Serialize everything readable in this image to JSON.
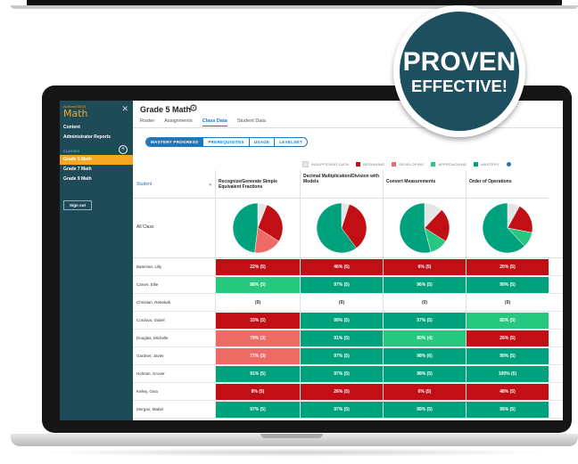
{
  "sidebar": {
    "brand_small": "Achieve3000",
    "brand_big": "Math",
    "nav": [
      "Content",
      "Administrator Reports"
    ],
    "classes_label": "CLASSES",
    "classes": [
      "Grade 5 Math",
      "Grade 7 Math",
      "Grade 9 Math"
    ],
    "active_class_index": 0,
    "sign_out": "Sign out"
  },
  "header": {
    "title": "Grade 5 Math",
    "tabs": [
      "Roster",
      "Assignments",
      "Class Data",
      "Student Data"
    ],
    "active_tab_index": 2
  },
  "subtabs": {
    "items": [
      "MASTERY PROGRESS",
      "PREREQUISITES",
      "USAGE",
      "LEVELSET"
    ],
    "active_index": 0
  },
  "legend": [
    {
      "label": "INSUFFICIENT DATA",
      "color": "#e6e6e6"
    },
    {
      "label": "BEGINNING",
      "color": "#c20e15"
    },
    {
      "label": "DEVELOPING",
      "color": "#ee6a64"
    },
    {
      "label": "APPROACHING",
      "color": "#26c77f"
    },
    {
      "label": "MASTERY",
      "color": "#00a27d"
    }
  ],
  "table": {
    "student_header": "Student",
    "all_class_label": "All Class",
    "columns": [
      "Recognize/Generate Simple Equivalent Fractions",
      "Decimal Multiplication/Division with Models",
      "Convert Measurements",
      "Order of Operations"
    ],
    "pies": [
      [
        0.06,
        0.28,
        0.18,
        0.0,
        0.48
      ],
      [
        0.05,
        0.35,
        0.0,
        0.0,
        0.6
      ],
      [
        0.12,
        0.22,
        0.0,
        0.12,
        0.54
      ],
      [
        0.08,
        0.2,
        0.0,
        0.1,
        0.62
      ]
    ],
    "rows": [
      {
        "name": "Bateman, Lilly",
        "cells": [
          [
            "22% (5)",
            "beg"
          ],
          [
            "46% (5)",
            "beg"
          ],
          [
            "6% (5)",
            "beg"
          ],
          [
            "20% (5)",
            "beg"
          ]
        ]
      },
      {
        "name": "Carver, Ellie",
        "cells": [
          [
            "88% (5)",
            "app"
          ],
          [
            "97% (5)",
            "mas"
          ],
          [
            "96% (5)",
            "mas"
          ],
          [
            "99% (5)",
            "mas"
          ]
        ]
      },
      {
        "name": "Christian, Rebekah",
        "cells": [
          [
            "(0)",
            "ins"
          ],
          [
            "(0)",
            "ins"
          ],
          [
            "(0)",
            "ins"
          ],
          [
            "(0)",
            "ins"
          ]
        ]
      },
      {
        "name": "Cordova, Izabel",
        "cells": [
          [
            "33% (5)",
            "beg"
          ],
          [
            "99% (5)",
            "mas"
          ],
          [
            "97% (5)",
            "mas"
          ],
          [
            "85% (5)",
            "app"
          ]
        ]
      },
      {
        "name": "Douglas, Michelle",
        "cells": [
          [
            "79% (3)",
            "dev"
          ],
          [
            "91% (5)",
            "mas"
          ],
          [
            "80% (4)",
            "app"
          ],
          [
            "26% (5)",
            "beg"
          ]
        ]
      },
      {
        "name": "Gardner, Javier",
        "cells": [
          [
            "77% (3)",
            "dev"
          ],
          [
            "97% (5)",
            "mas"
          ],
          [
            "98% (6)",
            "mas"
          ],
          [
            "99% (5)",
            "mas"
          ]
        ]
      },
      {
        "name": "Holman, Grover",
        "cells": [
          [
            "91% (5)",
            "mas"
          ],
          [
            "97% (5)",
            "mas"
          ],
          [
            "98% (5)",
            "mas"
          ],
          [
            "100% (5)",
            "mas"
          ]
        ]
      },
      {
        "name": "Kelley, Gina",
        "cells": [
          [
            "8% (5)",
            "beg"
          ],
          [
            "26% (5)",
            "beg"
          ],
          [
            "6% (5)",
            "beg"
          ],
          [
            "48% (5)",
            "beg"
          ]
        ]
      },
      {
        "name": "Morgan, Mabel",
        "cells": [
          [
            "97% (5)",
            "mas"
          ],
          [
            "97% (5)",
            "mas"
          ],
          [
            "99% (5)",
            "mas"
          ],
          [
            "99% (5)",
            "mas"
          ]
        ]
      }
    ]
  },
  "colors": {
    "beg": "#c20e15",
    "dev": "#ee6a64",
    "app": "#26c77f",
    "mas": "#00a27d",
    "ins": "#ffffff"
  },
  "badge": {
    "line1": "PROVEN",
    "line2": "EFFECTIVE!"
  }
}
